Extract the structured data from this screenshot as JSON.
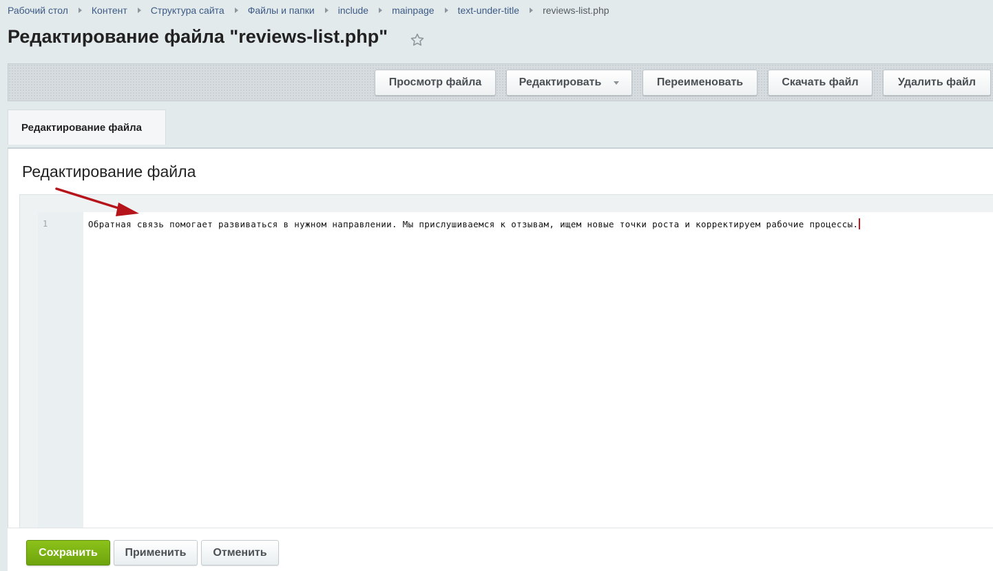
{
  "breadcrumb": {
    "items": [
      {
        "label": "Рабочий стол"
      },
      {
        "label": "Контент"
      },
      {
        "label": "Структура сайта"
      },
      {
        "label": "Файлы и папки"
      },
      {
        "label": "include"
      },
      {
        "label": "mainpage"
      },
      {
        "label": "text-under-title"
      },
      {
        "label": "reviews-list.php"
      }
    ]
  },
  "header": {
    "title": "Редактирование файла \"reviews-list.php\"",
    "favorite_icon": "star-outline-icon"
  },
  "toolbar": {
    "view_label": "Просмотр файла",
    "edit_label": "Редактировать",
    "rename_label": "Переименовать",
    "download_label": "Скачать файл",
    "delete_label": "Удалить файл"
  },
  "tabs": [
    {
      "label": "Редактирование файла",
      "active": true
    }
  ],
  "editor": {
    "section_title": "Редактирование файла",
    "lines": [
      {
        "number": "1",
        "text": "Обратная связь помогает развиваться в нужном направлении. Мы прислушиваемся к отзывам, ищем новые точки роста и корректируем рабочие процессы."
      }
    ]
  },
  "footer": {
    "save_label": "Сохранить",
    "apply_label": "Применить",
    "cancel_label": "Отменить"
  },
  "colors": {
    "save_button": "#7ab315",
    "link": "#3d5a85",
    "annotation_arrow": "#c3161c",
    "cursor": "#c3161c"
  }
}
